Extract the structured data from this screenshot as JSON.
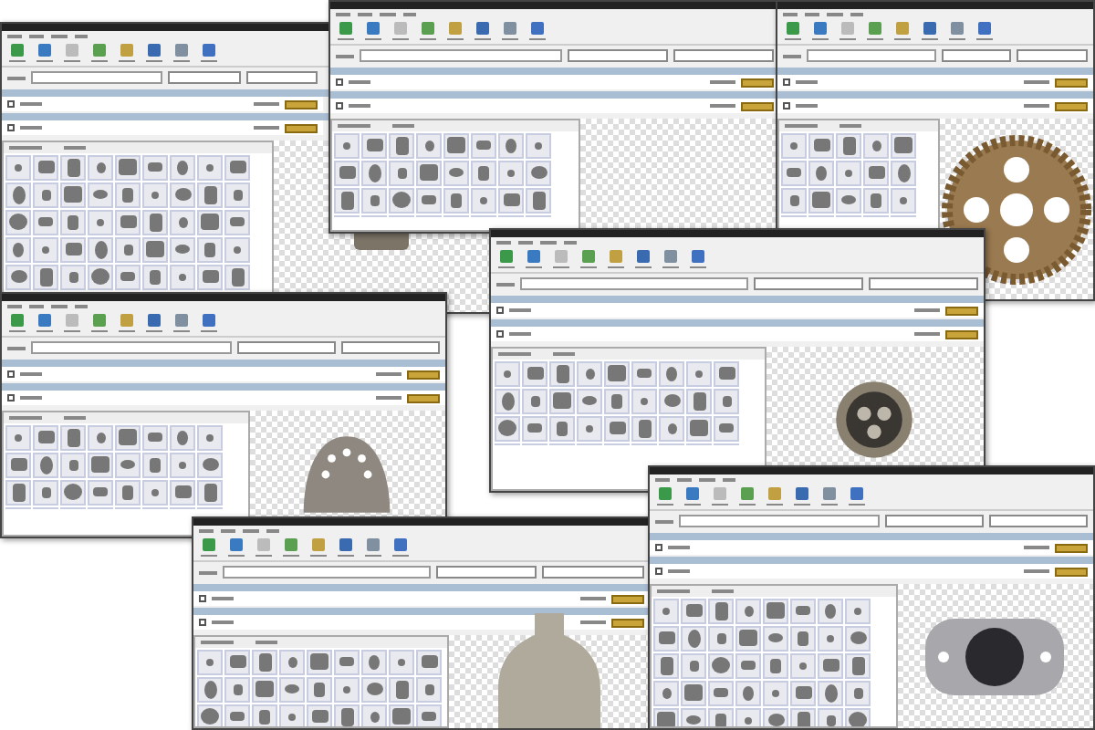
{
  "windows": [
    {
      "kind": "fitting"
    },
    {
      "kind": "none"
    },
    {
      "kind": "gear"
    },
    {
      "kind": "socket"
    },
    {
      "kind": "seat"
    },
    {
      "kind": "bottle"
    },
    {
      "kind": "plate"
    }
  ]
}
